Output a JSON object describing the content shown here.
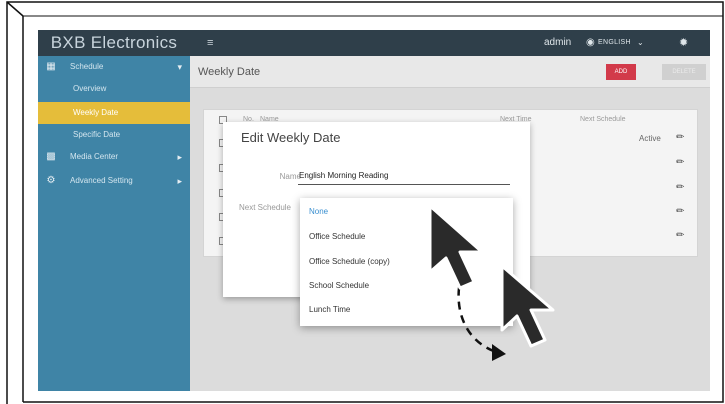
{
  "app": {
    "brand": "BXB Electronics"
  },
  "sidebar": {
    "items": [
      {
        "icon": "calendar-icon",
        "label": "Schedule",
        "expanded": true
      },
      {
        "label": "Overview"
      },
      {
        "label": "Weekly Date",
        "active": true
      },
      {
        "label": "Specific Date"
      },
      {
        "icon": "image-icon",
        "label": "Media Center"
      },
      {
        "icon": "gear-icon",
        "label": "Advanced Setting"
      }
    ]
  },
  "topbar": {
    "user": "admin",
    "language": "ENGLISH"
  },
  "header": {
    "title": "Weekly Date",
    "add_label": "ADD",
    "delete_label": "DELETE"
  },
  "table": {
    "columns": [
      "No.",
      "Name",
      "Next Time",
      "Next Schedule"
    ],
    "rows": [
      {
        "status": "Active"
      },
      {},
      {},
      {},
      {}
    ]
  },
  "dialog": {
    "title": "Edit Weekly Date",
    "name_label": "Name",
    "name_value": "English Morning Reading",
    "next_label": "Next Schedule"
  },
  "dropdown": {
    "options": [
      "None",
      "Office Schedule",
      "Office Schedule (copy)",
      "School Schedule",
      "Lunch Time"
    ],
    "selected": "None"
  },
  "colors": {
    "sidebar": "#3f84a6",
    "topbar": "#2f3f4a",
    "active_item": "#e5bd3a",
    "add_button": "#d23a4a",
    "selected_option": "#3a8fd0"
  }
}
